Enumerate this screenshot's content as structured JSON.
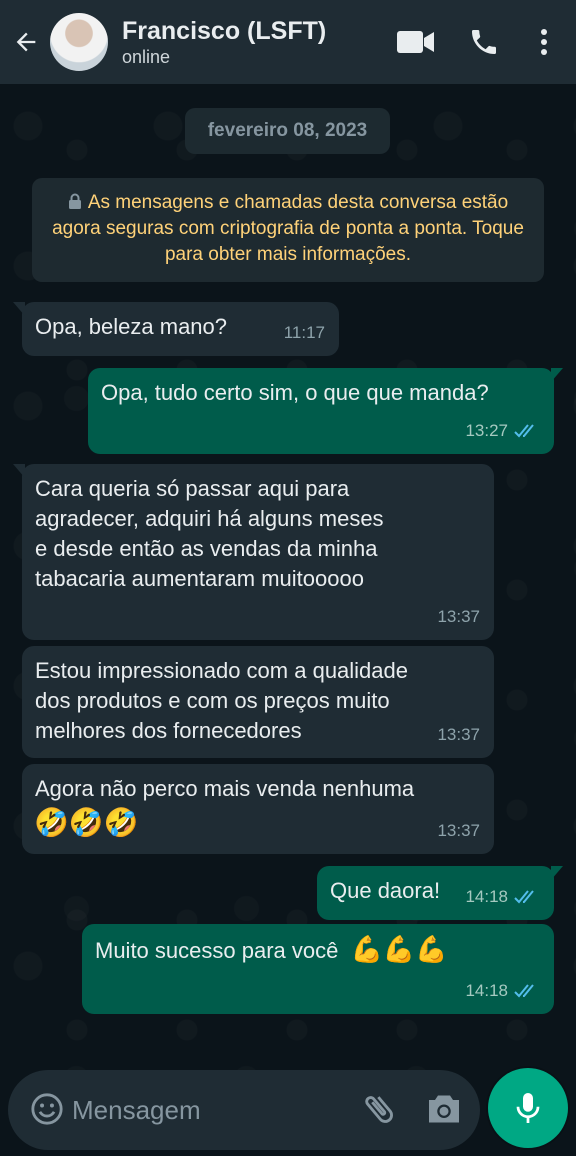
{
  "header": {
    "contact_name": "Francisco (LSFT)",
    "status": "online",
    "icons": [
      "back-arrow-icon",
      "video-call-icon",
      "phone-icon",
      "more-menu-icon"
    ]
  },
  "chat": {
    "date_chip": "fevereiro 08, 2023",
    "encryption_notice": "As mensagens e chamadas desta conversa estão agora seguras com criptografia de ponta a ponta. Toque para obter mais informações.",
    "messages": [
      {
        "direction": "in",
        "text": "Opa, beleza mano?",
        "time": "11:17"
      },
      {
        "direction": "out",
        "text": "Opa, tudo certo sim, o que que manda?",
        "time": "13:27",
        "status": "read"
      },
      {
        "direction": "in",
        "lines": [
          "Cara queria só passar aqui para",
          "agradecer, adquiri há alguns meses",
          "e desde então as vendas da minha",
          "tabacaria aumentaram muitooooo"
        ],
        "time": "13:37"
      },
      {
        "direction": "in",
        "lines": [
          "Estou impressionado com a qualidade",
          "dos produtos e com os preços muito",
          "melhores dos fornecedores"
        ],
        "time": "13:37"
      },
      {
        "direction": "in",
        "text": "Agora não perco mais venda nenhuma",
        "emoji": "🤣🤣🤣",
        "time": "13:37"
      },
      {
        "direction": "out",
        "text": "Que daora!",
        "time": "14:18",
        "status": "read"
      },
      {
        "direction": "out",
        "text": "Muito sucesso para você",
        "emoji": "💪💪💪",
        "time": "14:18",
        "status": "read"
      }
    ]
  },
  "composer": {
    "placeholder": "Mensagem",
    "icons": [
      "emoji-icon",
      "attach-icon",
      "camera-icon",
      "microphone-icon"
    ]
  },
  "colors": {
    "header_bg": "#1f2c34",
    "chat_bg": "#0b141a",
    "incoming_bubble": "#1f2c34",
    "outgoing_bubble": "#005c4b",
    "read_ticks": "#53bdeb",
    "accent": "#00a884",
    "encryption_text": "#ffd279"
  }
}
